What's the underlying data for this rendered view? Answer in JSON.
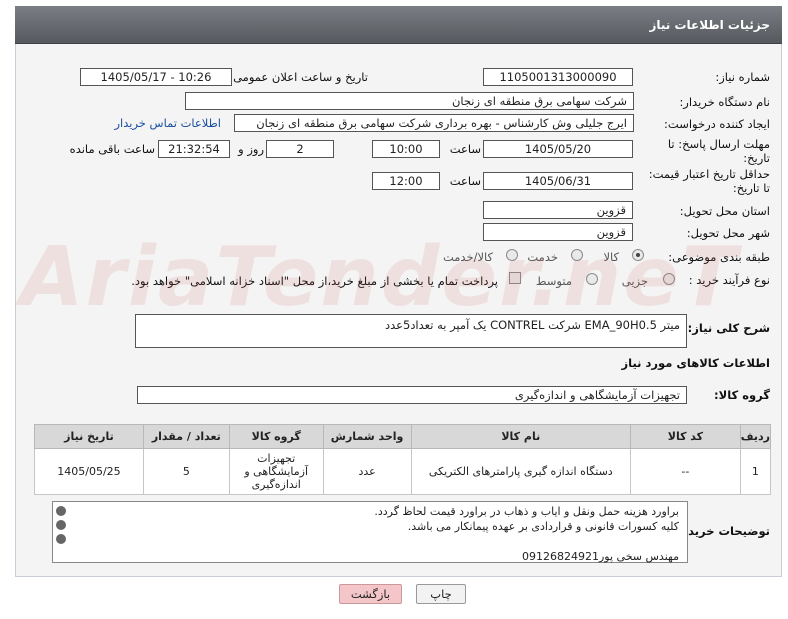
{
  "header": {
    "title": "جزئیات اطلاعات نیاز"
  },
  "form": {
    "need_number": {
      "label": "شماره نیاز:",
      "value": "1105001313000090"
    },
    "announce_datetime": {
      "label": "تاریخ و ساعت اعلان عمومی:",
      "value": "1405/05/17 - 10:26"
    },
    "buyer_org": {
      "label": "نام دستگاه خریدار:",
      "value": "شرکت سهامی برق منطقه ای زنجان"
    },
    "creator": {
      "label": "ایجاد کننده درخواست:",
      "value": "ایرج جلیلی وش کارشناس - بهره برداری شرکت سهامی برق منطقه ای زنجان",
      "link": "اطلاعات تماس خریدار"
    },
    "reply_deadline": {
      "label": "مهلت ارسال پاسخ: تا تاریخ:",
      "date": "1405/05/20",
      "time_label": "ساعت",
      "time": "10:00",
      "days": "2",
      "days_label": "روز و",
      "remaining": "21:32:54",
      "remaining_label": "ساعت باقی مانده"
    },
    "price_validity": {
      "label": "حداقل تاریخ اعتبار قیمت: تا تاریخ:",
      "date": "1405/06/31",
      "time_label": "ساعت",
      "time": "12:00"
    },
    "province": {
      "label": "استان محل تحویل:",
      "value": "قزوین"
    },
    "city": {
      "label": "شهر محل تحویل:",
      "value": "قزوین"
    },
    "category": {
      "label": "طبقه بندی موضوعی:",
      "options": [
        "کالا",
        "خدمت",
        "کالا/خدمت"
      ],
      "selected": 0
    },
    "process": {
      "label": "نوع فرآیند خرید :",
      "options": [
        "جزیی",
        "متوسط"
      ],
      "payment_note": "پرداخت تمام یا بخشی از مبلغ خرید،از محل \"اسناد خزانه اسلامی\" خواهد بود."
    },
    "general_desc": {
      "label": "شرح کلی نیاز:",
      "value": "میتر EMA_90H0.5 شرکت CONTREL  یک آمپر به تعداد5عدد"
    }
  },
  "goods": {
    "section_title": "اطلاعات کالاهای مورد نیاز",
    "group_label": "گروه کالا:",
    "group_value": "تجهیزات آزمایشگاهی و اندازه‌گیری",
    "columns": [
      "ردیف",
      "کد کالا",
      "نام کالا",
      "واحد شمارش",
      "گروه کالا",
      "تعداد / مقدار",
      "تاریخ نیاز"
    ],
    "rows": [
      {
        "row": "1",
        "code": "--",
        "name": "دستگاه اندازه گیری پارامترهای الکتریکی",
        "unit": "عدد",
        "group": "تجهیزات آزمایشگاهی و اندازه‌گیری",
        "qty": "5",
        "date": "1405/05/25"
      }
    ]
  },
  "buyer_notes": {
    "label": "توضیحات خریدار:",
    "lines": [
      "براورد هزینه حمل  ونقل و ایاب و ذهاب در براورد قیمت لحاظ گردد.",
      "کلیه کسورات  قانونی و قراردادی بر عهده پیمانکار می باشد.",
      "",
      "مهندس سخی پور09126824921"
    ]
  },
  "buttons": {
    "print": "چاپ",
    "back": "بازگشت"
  },
  "colors": {
    "header_bg": "#6b6f75",
    "link": "#1a4fa0",
    "back_button": "#f4c6c9"
  }
}
